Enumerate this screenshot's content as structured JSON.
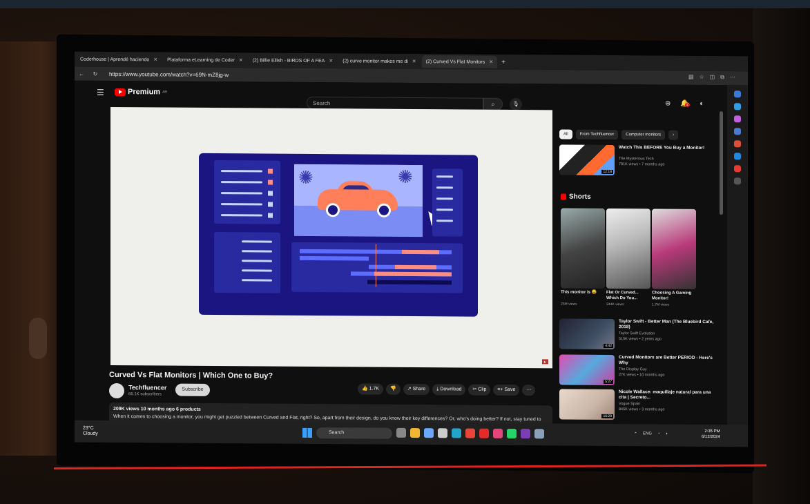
{
  "browser": {
    "tabs": [
      {
        "label": "Coderhouse | Aprendé haciendo",
        "active": false
      },
      {
        "label": "Plataforma eLearning de Coder",
        "active": false
      },
      {
        "label": "(2) Billie Eilish - BIRDS OF A FEA",
        "active": false
      },
      {
        "label": "(2) curve monitor makes me di",
        "active": false
      },
      {
        "label": "(2) Curved Vs Flat Monitors",
        "active": true
      }
    ],
    "new_tab": "+",
    "url": "https://www.youtube.com/watch?v=69N-mZ8jg-w"
  },
  "youtube": {
    "logo_text": "Premium",
    "logo_region": "AR",
    "search_placeholder": "Search",
    "notification_count": "2"
  },
  "video": {
    "title": "Curved Vs Flat Monitors | Which One to Buy?",
    "channel": "Techfluencer",
    "subscribers": "66.1K subscribers",
    "subscribe_label": "Subscribe",
    "likes": "1.7K",
    "share_label": "Share",
    "download_label": "Download",
    "clip_label": "Clip",
    "save_label": "Save",
    "more_label": "···",
    "views_meta": "209K views  10 months ago  6 products",
    "description": "When it comes to choosing a monitor, you might get puzzled between Curved and Flat, right? So, apart from their design, do you know their key differences? Or, who's doing better? If not, stay tuned to"
  },
  "chips": [
    {
      "label": "All",
      "selected": true
    },
    {
      "label": "From Techfluencer",
      "selected": false
    },
    {
      "label": "Computer monitors",
      "selected": false
    }
  ],
  "recommendations": [
    {
      "title": "Watch This BEFORE You Buy a Monitor!",
      "channel": "The Mysterious Tech",
      "meta": "791K views • 7 months ago",
      "duration": "12:18",
      "color": "#3a3a44"
    },
    {
      "title": "Taylor Swift - Better Man (The Bluebird Cafe, 2018)",
      "channel": "Taylor Swift Evolution",
      "meta": "515K views • 2 years ago",
      "duration": "4:42",
      "color": "#3c4d62"
    },
    {
      "title": "Curved Monitors are Better PERIOD - Here's Why",
      "channel": "The Display Guy",
      "meta": "27K views • 10 months ago",
      "duration": "5:27",
      "color": "#d23aa0"
    },
    {
      "title": "Nicole Wallace: maquillaje natural para una cita | Secreto...",
      "channel": "Vogue Spain",
      "meta": "845K views • 3 months ago",
      "duration": "16:29",
      "color": "#c9b6a8"
    }
  ],
  "shorts": {
    "heading": "Shorts",
    "items": [
      {
        "title": "This monitor is 😂",
        "views": "23M views",
        "color": "#556"
      },
      {
        "title": "Flat Or Curved... Which Do You...",
        "views": "244K views",
        "color": "#d6c7e8"
      },
      {
        "title": "Choosing A Gaming Monitor!",
        "views": "1.7M views",
        "color": "#b83a7a"
      }
    ]
  },
  "taskbar": {
    "temperature": "23°C",
    "condition": "Cloudy",
    "search_label": "Search",
    "lang": "ENG",
    "time": "2:35 PM",
    "date": "6/12/2024"
  },
  "colors": {
    "accent": "#ff0000",
    "frame_lines": "#e0231f",
    "illustration_bg": "#1a1580"
  }
}
